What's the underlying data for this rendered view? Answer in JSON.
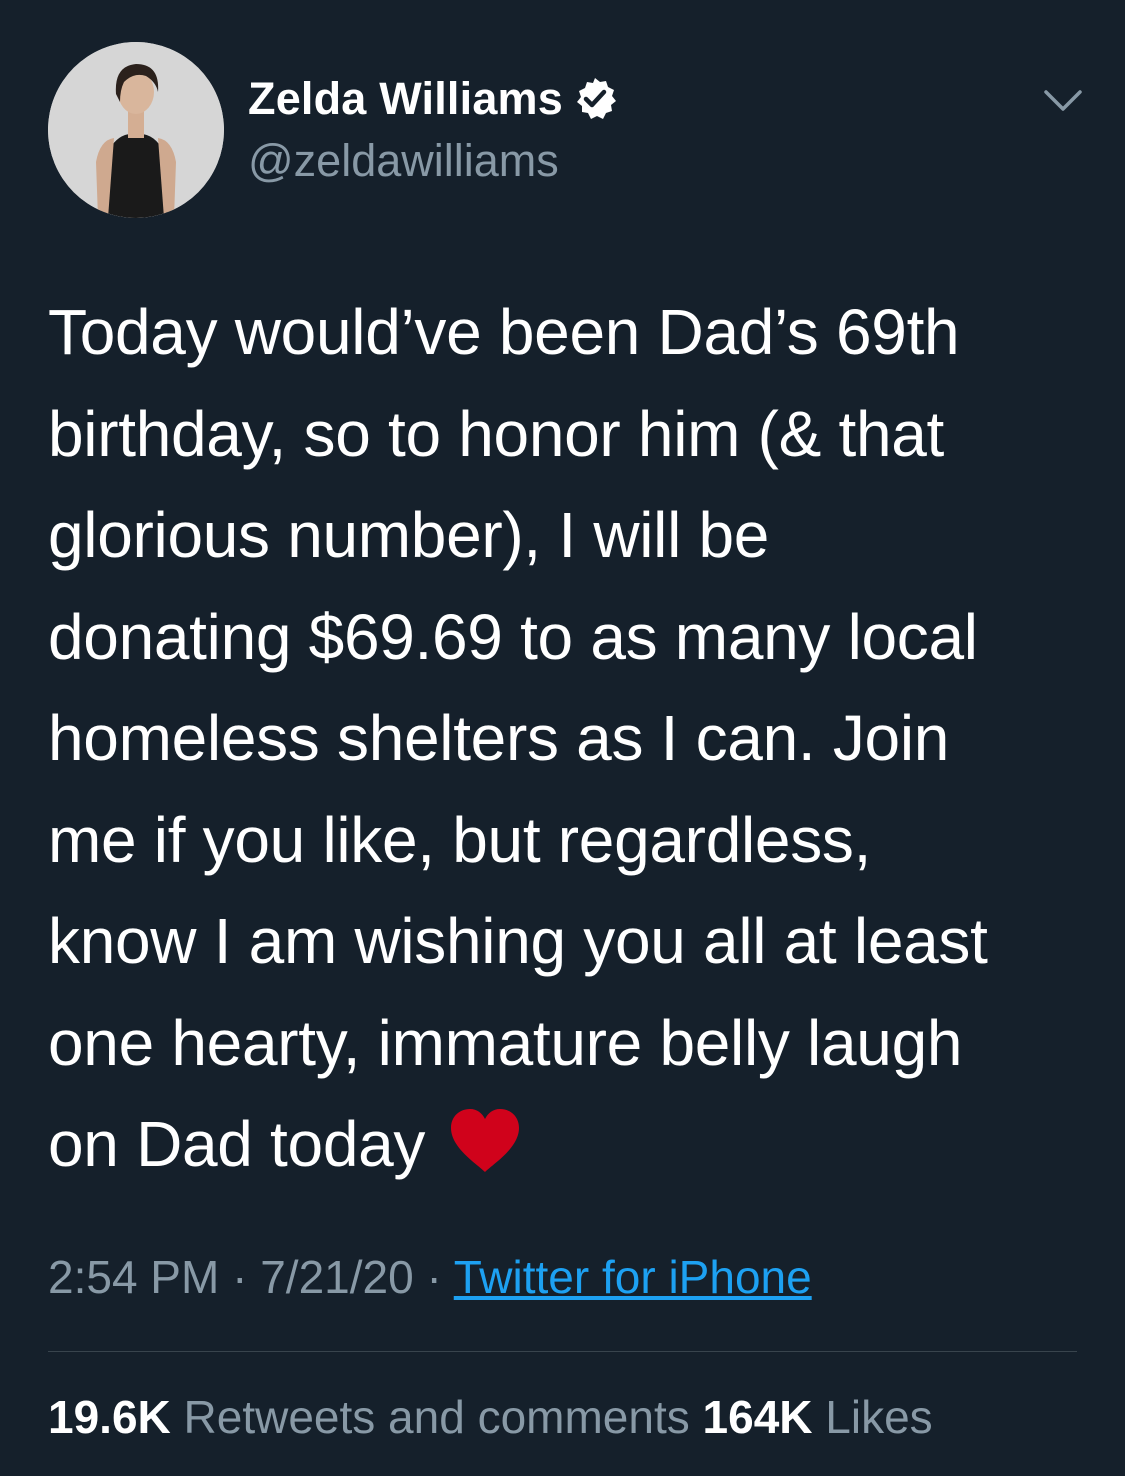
{
  "colors": {
    "background": "#15202b",
    "text_primary": "#ffffff",
    "text_secondary": "#8899a6",
    "link": "#1da1f2",
    "divider": "#38444d",
    "verified_badge": "#ffffff",
    "heart": "#d0021b"
  },
  "author": {
    "display_name": "Zelda Williams",
    "handle": "@zeldawilliams",
    "verified_icon": "verified-badge-icon",
    "avatar_icon": "profile-photo"
  },
  "menu": {
    "icon": "chevron-down-icon"
  },
  "tweet": {
    "text": "Today would’ve been Dad’s 69th\nbirthday, so to honor him (& that\nglorious number), I will be\ndonating $69.69 to as many local\nhomeless shelters as I can. Join\nme if you like, but regardless,\nknow I am wishing you all at least\none hearty, immature belly laugh\non Dad today ",
    "emoji": "red-heart-icon"
  },
  "meta": {
    "time": "2:54 PM",
    "separator1": " · ",
    "date": "7/21/20",
    "separator2": " · ",
    "source": "Twitter for iPhone"
  },
  "stats": {
    "retweets_count": "19.6K",
    "retweets_label": " Retweets and comments  ",
    "likes_count": "164K",
    "likes_label": " Likes"
  }
}
